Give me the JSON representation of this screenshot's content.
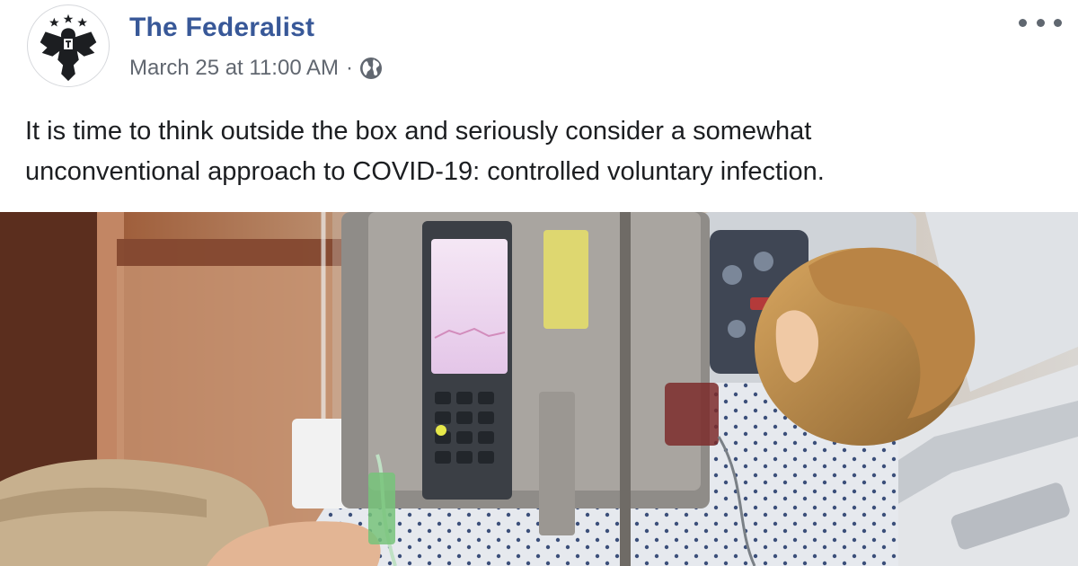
{
  "post": {
    "page_name": "The Federalist",
    "timestamp": "March 25 at 11:00 AM",
    "separator": "·",
    "privacy_icon": "globe-icon",
    "more_icon": "more-options-icon",
    "avatar_icon": "eagle-logo",
    "text_lines": [
      "It is time to think outside the box and seriously consider a somewhat",
      "unconventional approach to COVID-19: controlled voluntary infection."
    ],
    "image_subject": "photo-patient-in-hospital-bed"
  },
  "colors": {
    "link_blue": "#385898",
    "meta_gray": "#616770",
    "text": "#1c1e21"
  }
}
